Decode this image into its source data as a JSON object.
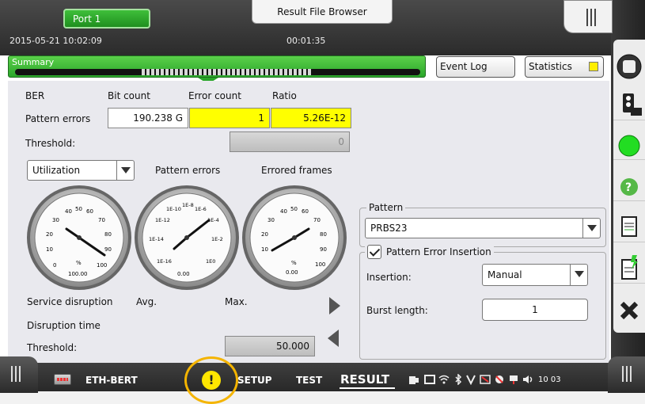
{
  "header": {
    "port_tab": "Port 1",
    "result_file_browser": "Result File Browser",
    "datetime": "2015-05-21 10:02:09",
    "elapsed": "00:01:35"
  },
  "summary": {
    "label": "Summary",
    "event_log": "Event Log",
    "statistics": "Statistics"
  },
  "ber": {
    "title": "BER",
    "col_bit_count": "Bit count",
    "col_error_count": "Error count",
    "col_ratio": "Ratio",
    "row_label": "Pattern errors",
    "bit_count": "190.238 G",
    "error_count": "1",
    "ratio": "5.26E-12",
    "threshold_label": "Threshold:",
    "threshold_value": "0"
  },
  "gauges": {
    "selector": "Utilization",
    "pattern_errors_label": "Pattern errors",
    "errored_frames_label": "Errored frames",
    "util_ticks": [
      "0",
      "10",
      "20",
      "30",
      "40",
      "50",
      "60",
      "70",
      "80",
      "90",
      "100"
    ],
    "util_unit": "%",
    "util_value": "100.00",
    "pe_ticks": [
      "1E-16",
      "1E-14",
      "1E-12",
      "1E-10",
      "1E-8",
      "1E-6",
      "1E-4",
      "1E-2",
      "1E0"
    ],
    "pe_value": "0.00",
    "ef_ticks": [
      "0",
      "10",
      "20",
      "30",
      "40",
      "50",
      "60",
      "70",
      "80",
      "90",
      "100"
    ],
    "ef_unit": "%",
    "ef_value": "0.00"
  },
  "disruption": {
    "service_disruption": "Service disruption",
    "avg": "Avg.",
    "max": "Max.",
    "disruption_time": "Disruption time",
    "threshold_label": "Threshold:",
    "threshold_value": "50.000"
  },
  "pattern": {
    "legend": "Pattern",
    "value": "PRBS23"
  },
  "insertion": {
    "legend": "Pattern Error Insertion",
    "insertion_label": "Insertion:",
    "insertion_value": "Manual",
    "burst_label": "Burst length:",
    "burst_value": "1"
  },
  "bottom": {
    "module": "ETH-BERT",
    "setup": "SETUP",
    "test": "TEST",
    "result": "RESULT",
    "clock": "10 03"
  },
  "colors": {
    "green": "#2aa62a",
    "yellow": "#ffff00",
    "warning": "#f4b400"
  },
  "icons": [
    "menu-icon",
    "stop-icon",
    "traffic-light-icon",
    "status-led-icon",
    "help-icon",
    "report-icon",
    "quick-report-icon",
    "close-icon",
    "warning-icon",
    "module-icon",
    "wifi-icon",
    "bluetooth-icon",
    "volume-icon"
  ]
}
